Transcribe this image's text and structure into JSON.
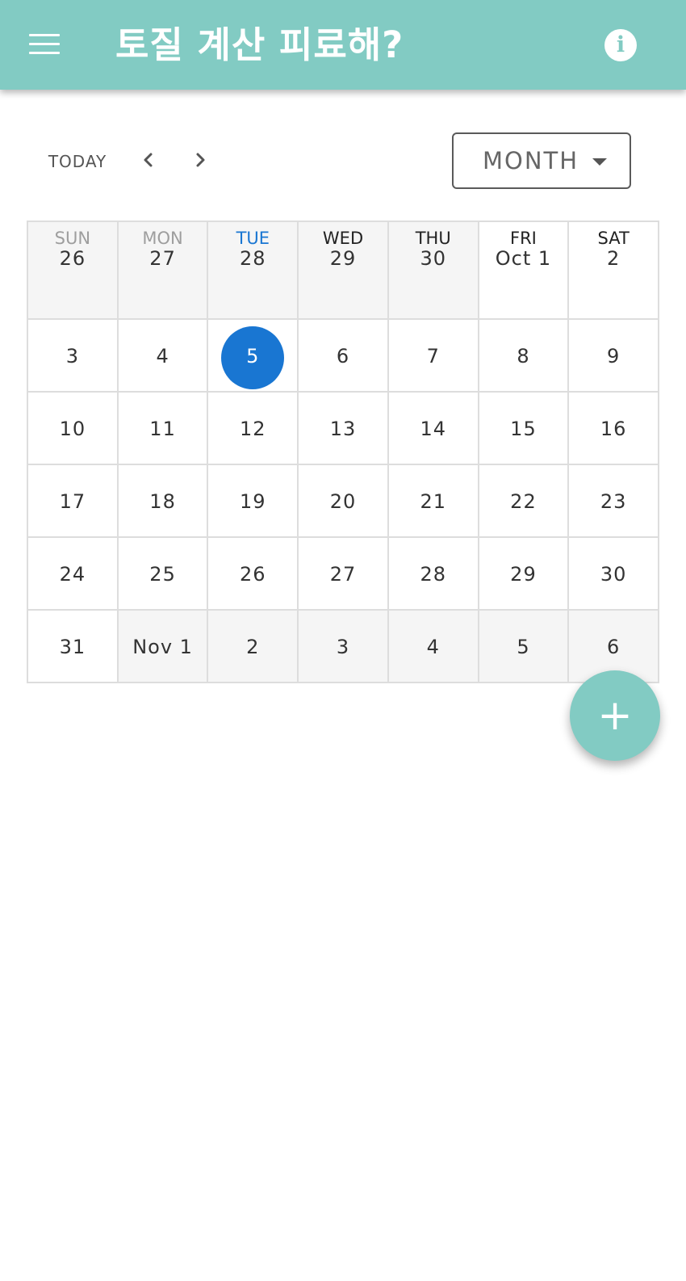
{
  "app_bar": {
    "title": "토질 계산 피료해?",
    "menu_icon": "menu-icon",
    "info_icon": "info-icon",
    "info_glyph": "i",
    "background_color": "#82cbc3"
  },
  "toolbar": {
    "today_label": "TODAY",
    "prev_icon": "chevron-left-icon",
    "next_icon": "chevron-right-icon",
    "view_select": {
      "selected": "MONTH",
      "icon": "caret-down-icon"
    }
  },
  "calendar": {
    "weekdays": [
      {
        "label": "SUN",
        "color": "#9e9e9e"
      },
      {
        "label": "MON",
        "color": "#9e9e9e"
      },
      {
        "label": "TUE",
        "color": "#1976d2"
      },
      {
        "label": "WED",
        "color": "#222222"
      },
      {
        "label": "THU",
        "color": "#222222"
      },
      {
        "label": "FRI",
        "color": "#222222"
      },
      {
        "label": "SAT",
        "color": "#222222"
      }
    ],
    "today_color": "#1976d2",
    "weeks": [
      [
        {
          "label": "26",
          "outside": true
        },
        {
          "label": "27",
          "outside": true
        },
        {
          "label": "28",
          "outside": true
        },
        {
          "label": "29",
          "outside": true
        },
        {
          "label": "30",
          "outside": true
        },
        {
          "label": "Oct 1",
          "outside": false
        },
        {
          "label": "2",
          "outside": false
        }
      ],
      [
        {
          "label": "3",
          "outside": false
        },
        {
          "label": "4",
          "outside": false
        },
        {
          "label": "5",
          "outside": false,
          "today": true
        },
        {
          "label": "6",
          "outside": false
        },
        {
          "label": "7",
          "outside": false
        },
        {
          "label": "8",
          "outside": false
        },
        {
          "label": "9",
          "outside": false
        }
      ],
      [
        {
          "label": "10",
          "outside": false
        },
        {
          "label": "11",
          "outside": false
        },
        {
          "label": "12",
          "outside": false
        },
        {
          "label": "13",
          "outside": false
        },
        {
          "label": "14",
          "outside": false
        },
        {
          "label": "15",
          "outside": false
        },
        {
          "label": "16",
          "outside": false
        }
      ],
      [
        {
          "label": "17",
          "outside": false
        },
        {
          "label": "18",
          "outside": false
        },
        {
          "label": "19",
          "outside": false
        },
        {
          "label": "20",
          "outside": false
        },
        {
          "label": "21",
          "outside": false
        },
        {
          "label": "22",
          "outside": false
        },
        {
          "label": "23",
          "outside": false
        }
      ],
      [
        {
          "label": "24",
          "outside": false
        },
        {
          "label": "25",
          "outside": false
        },
        {
          "label": "26",
          "outside": false
        },
        {
          "label": "27",
          "outside": false
        },
        {
          "label": "28",
          "outside": false
        },
        {
          "label": "29",
          "outside": false
        },
        {
          "label": "30",
          "outside": false
        }
      ],
      [
        {
          "label": "31",
          "outside": false
        },
        {
          "label": "Nov 1",
          "outside": true
        },
        {
          "label": "2",
          "outside": true
        },
        {
          "label": "3",
          "outside": true
        },
        {
          "label": "4",
          "outside": true
        },
        {
          "label": "5",
          "outside": true
        },
        {
          "label": "6",
          "outside": true
        }
      ]
    ]
  },
  "fab": {
    "icon": "plus-icon",
    "glyph": "+"
  }
}
